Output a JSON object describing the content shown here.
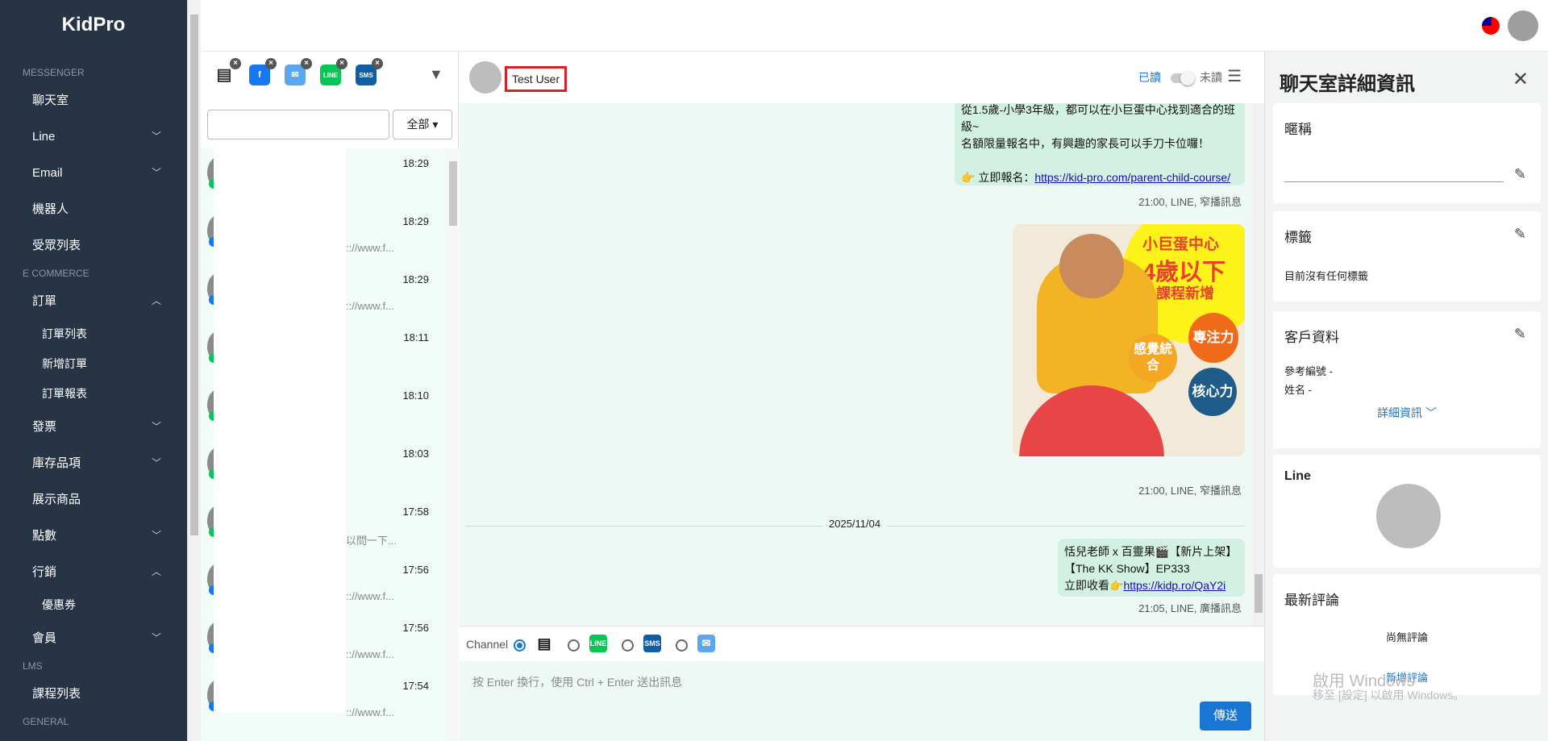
{
  "sidebar": {
    "brand": "KidPro",
    "sections": {
      "messenger": "MESSENGER",
      "ecommerce": "E COMMERCE",
      "lms": "LMS",
      "general": "GENERAL"
    },
    "items": [
      "聊天室",
      "Line",
      "Email",
      "機器人",
      "受眾列表",
      "訂單",
      "訂單列表",
      "新增訂單",
      "訂單報表",
      "發票",
      "庫存品項",
      "展示商品",
      "點數",
      "行銷",
      "優惠券",
      "會員",
      "課程列表"
    ]
  },
  "channels": {
    "sms": "SMS",
    "line": "LINE"
  },
  "search": {
    "placeholder": "",
    "filter_label": "全部"
  },
  "conversations": [
    {
      "time": "18:29",
      "snippet": ""
    },
    {
      "time": "18:29",
      "snippet": ":://www.f..."
    },
    {
      "time": "18:29",
      "snippet": ":://www.f..."
    },
    {
      "time": "18:11",
      "snippet": ""
    },
    {
      "time": "18:10",
      "snippet": ""
    },
    {
      "time": "18:03",
      "snippet": ""
    },
    {
      "time": "17:58",
      "snippet": "以問一下..."
    },
    {
      "time": "17:56",
      "snippet": ":://www.f..."
    },
    {
      "time": "17:56",
      "snippet": ":://www.f..."
    },
    {
      "time": "17:54",
      "snippet": ":://www.f..."
    }
  ],
  "chat": {
    "user_name": "Test User",
    "read_label": "已讀",
    "unread_label": "未讀",
    "msg1": {
      "line1": "從1.5歲-小學3年級，都可以在小巨蛋中心找到適合的班",
      "line2": "級~",
      "line3": "名額限量報名中，有興趣的家長可以手刀卡位囉！",
      "line5_prefix": "👉 立即報名：",
      "link": "https://kid-pro.com/parent-child-course/",
      "meta": "21:00, LINE, 窄播訊息"
    },
    "promo": {
      "t1": "小巨蛋中心",
      "t2": "4歲以下",
      "t3": "課程新增",
      "c1": "專注力",
      "c2": "感覺統合",
      "c3": "核心力"
    },
    "msg2_meta": "21:00, LINE, 窄播訊息",
    "date": "2025/11/04",
    "msg3": {
      "line1": "恬兒老師 x 百靈果🎬【新片上架】",
      "line2": "【The KK Show】EP333",
      "line3_prefix": "立即收看👉",
      "link": "https://kidp.ro/QaY2i",
      "meta": "21:05, LINE, 廣播訊息"
    },
    "channel_label": "Channel",
    "composer_placeholder": "按 Enter 換行，使用 Ctrl + Enter 送出訊息",
    "send_label": "傳送"
  },
  "details": {
    "title": "聊天室詳細資訊",
    "nickname_title": "暱稱",
    "tags_title": "標籤",
    "tags_empty": "目前沒有任何標籤",
    "customer_title": "客戶資料",
    "ref_no": "參考編號 -",
    "name": "姓名 -",
    "more_label": "詳細資訊",
    "line_title": "Line",
    "reviews_title": "最新評論",
    "reviews_empty": "尚無評論",
    "add_review": "新增評論"
  },
  "watermark": {
    "line1": "啟用 Windows",
    "line2": "移至 [設定] 以啟用 Windows。"
  },
  "colors": {
    "sidebar": "#263445",
    "accent": "#1976d2",
    "chat_bg": "#eef8f5",
    "bubble": "#d3f1e3",
    "highlight": "#d91f26"
  }
}
